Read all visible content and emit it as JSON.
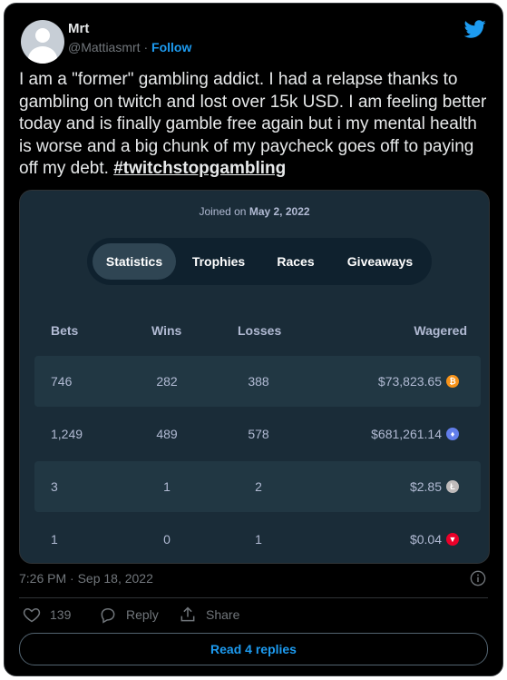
{
  "tweet": {
    "author_name": "Mrt",
    "handle": "@Mattiasmrt",
    "separator": "·",
    "follow_label": "Follow",
    "text": "I am a \"former\" gambling addict. I had a relapse thanks to gambling on twitch and lost over 15k USD. I am feeling better today and is finally gamble free again but i my mental health is worse and a big chunk of my paycheck goes off to paying off my debt.",
    "hashtag": "#twitchstopgambling",
    "timestamp": "7:26 PM · Sep 18, 2022",
    "like_count": "139",
    "reply_label": "Reply",
    "share_label": "Share",
    "read_replies_label": "Read 4 replies",
    "colors": {
      "accent": "#1d9bf0",
      "background": "#000000",
      "text": "#e7e9ea",
      "muted": "#71767b"
    }
  },
  "stats_card": {
    "joined_prefix": "Joined on",
    "joined_date": "May 2, 2022",
    "tabs": [
      {
        "label": "Statistics",
        "active": true
      },
      {
        "label": "Trophies",
        "active": false
      },
      {
        "label": "Races",
        "active": false
      },
      {
        "label": "Giveaways",
        "active": false
      }
    ],
    "columns": [
      "Bets",
      "Wins",
      "Losses",
      "Wagered"
    ],
    "rows": [
      {
        "bets": "746",
        "wins": "282",
        "losses": "388",
        "wagered": "$73,823.65",
        "coin": "bitcoin-icon",
        "coin_color": "#f7931a"
      },
      {
        "bets": "1,249",
        "wins": "489",
        "losses": "578",
        "wagered": "$681,261.14",
        "coin": "ethereum-icon",
        "coin_color": "#627eea"
      },
      {
        "bets": "3",
        "wins": "1",
        "losses": "2",
        "wagered": "$2.85",
        "coin": "litecoin-icon",
        "coin_color": "#bfbbbb"
      },
      {
        "bets": "1",
        "wins": "0",
        "losses": "1",
        "wagered": "$0.04",
        "coin": "tron-icon",
        "coin_color": "#eb0029"
      }
    ],
    "colors": {
      "card_bg": "#1a2c38",
      "row_alt": "#213743",
      "tab_active": "#2f4553",
      "muted": "#b1bad3"
    }
  }
}
